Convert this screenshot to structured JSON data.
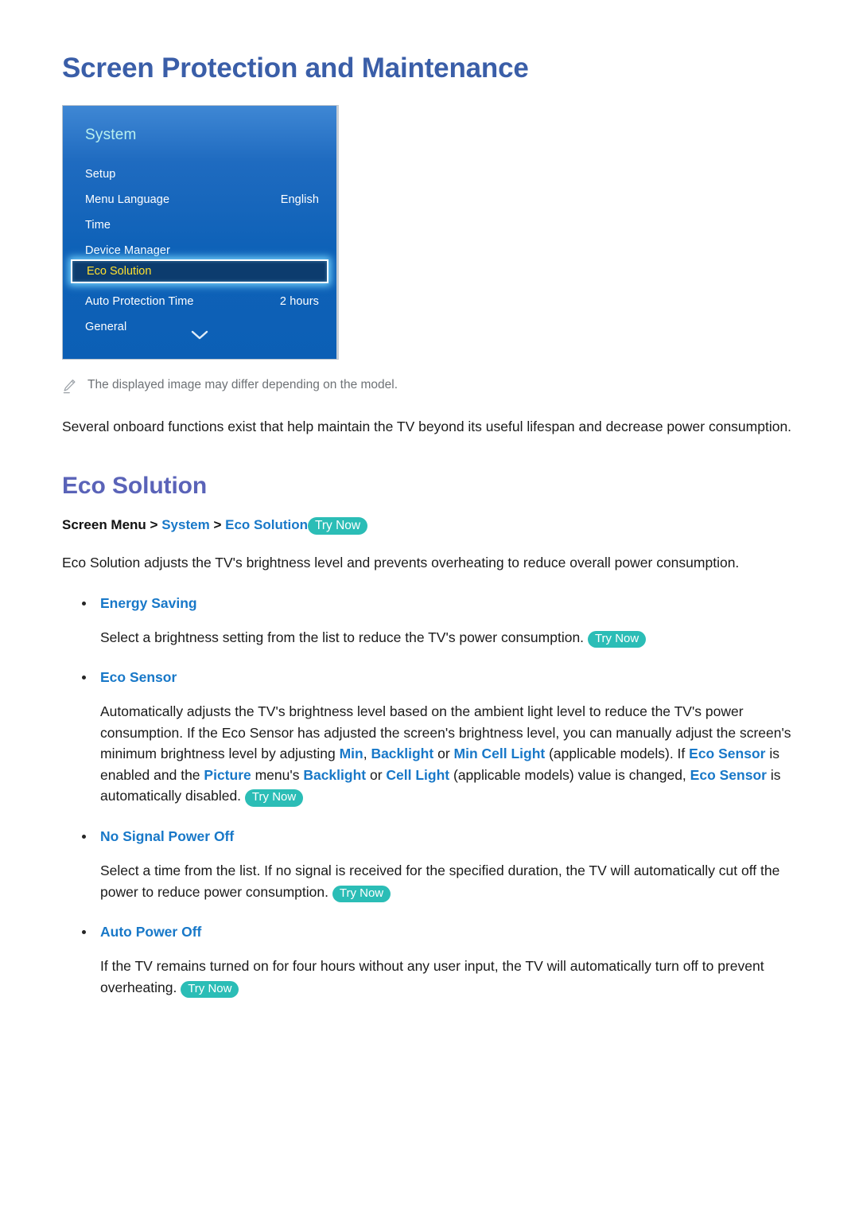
{
  "page": {
    "title": "Screen Protection and Maintenance"
  },
  "tv_menu": {
    "panel_title": "System",
    "selected_item": "Eco Solution",
    "scroll_icon": "chevron-down-icon",
    "rows": [
      {
        "label": "Setup",
        "value": ""
      },
      {
        "label": "Menu Language",
        "value": "English"
      },
      {
        "label": "Time",
        "value": ""
      },
      {
        "label": "Device Manager",
        "value": ""
      },
      {
        "label": "Eco Solution",
        "value": "",
        "selected": true
      },
      {
        "label": "Auto Protection Time",
        "value": "2 hours"
      },
      {
        "label": "General",
        "value": ""
      }
    ]
  },
  "note": {
    "icon": "pencil-icon",
    "text": "The displayed image may differ depending on the model."
  },
  "intro": "Several onboard functions exist that help maintain the TV beyond its useful lifespan and decrease power consumption.",
  "section": {
    "heading": "Eco Solution",
    "breadcrumb": {
      "root": "Screen Menu",
      "sep1": ">",
      "item1": "System",
      "sep2": ">",
      "item2": "Eco Solution",
      "try_now": "Try Now"
    },
    "description": "Eco Solution adjusts the TV's brightness level and prevents overheating to reduce overall power consumption."
  },
  "bullets": [
    {
      "title": "Energy Saving",
      "body_1": "Select a brightness setting from the list to reduce the TV's power consumption.",
      "try_now": "Try Now"
    },
    {
      "title": "Eco Sensor",
      "body_1": "Automatically adjusts the TV's brightness level based on the ambient light level to reduce the TV's power consumption. If the Eco Sensor has adjusted the screen's brightness level, you can manually adjust the screen's minimum brightness level by adjusting ",
      "hl_1": "Min",
      "body_2": ", ",
      "hl_2": "Backlight",
      "body_3": " or ",
      "hl_3": "Min Cell Light",
      "body_4": " (applicable models). If ",
      "hl_4": "Eco Sensor",
      "body_5": " is enabled and the ",
      "hl_5": "Picture",
      "body_6": " menu's ",
      "hl_6": "Backlight",
      "body_7": " or ",
      "hl_7": "Cell Light",
      "body_8": " (applicable models) value is changed, ",
      "hl_8": "Eco Sensor",
      "body_9": " is automatically disabled.",
      "try_now": "Try Now"
    },
    {
      "title": "No Signal Power Off",
      "body_1": "Select a time from the list. If no signal is received for the specified duration, the TV will automatically cut off the power to reduce power consumption.",
      "try_now": "Try Now"
    },
    {
      "title": "Auto Power Off",
      "body_1": "If the TV remains turned on for four hours without any user input, the TV will automatically turn off to prevent overheating.",
      "try_now": "Try Now"
    }
  ],
  "colors": {
    "page_title": "#3a5ea8",
    "section_heading": "#5a63b8",
    "link_blue": "#1878c8",
    "try_now_bg": "#2bbdb6",
    "menu_selected_text": "#ffe02e",
    "menu_panel_blue": "#0f62b8"
  }
}
